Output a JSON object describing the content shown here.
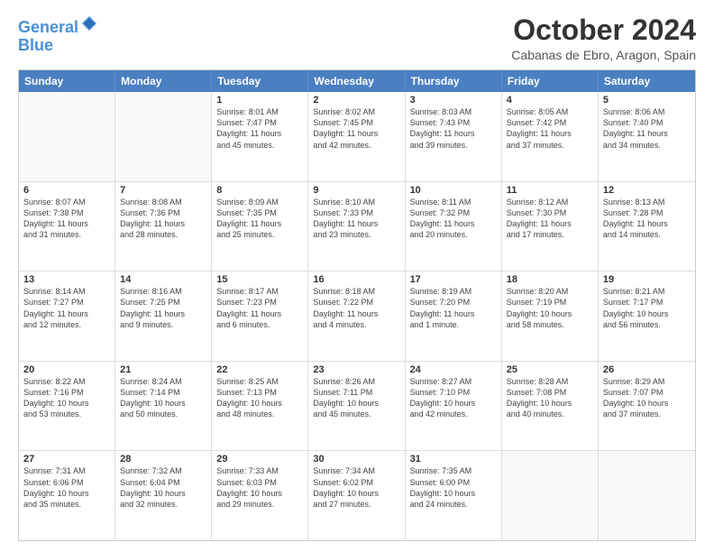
{
  "header": {
    "logo_line1": "General",
    "logo_line2": "Blue",
    "month_title": "October 2024",
    "location": "Cabanas de Ebro, Aragon, Spain"
  },
  "weekdays": [
    "Sunday",
    "Monday",
    "Tuesday",
    "Wednesday",
    "Thursday",
    "Friday",
    "Saturday"
  ],
  "weeks": [
    [
      {
        "day": "",
        "lines": []
      },
      {
        "day": "",
        "lines": []
      },
      {
        "day": "1",
        "lines": [
          "Sunrise: 8:01 AM",
          "Sunset: 7:47 PM",
          "Daylight: 11 hours",
          "and 45 minutes."
        ]
      },
      {
        "day": "2",
        "lines": [
          "Sunrise: 8:02 AM",
          "Sunset: 7:45 PM",
          "Daylight: 11 hours",
          "and 42 minutes."
        ]
      },
      {
        "day": "3",
        "lines": [
          "Sunrise: 8:03 AM",
          "Sunset: 7:43 PM",
          "Daylight: 11 hours",
          "and 39 minutes."
        ]
      },
      {
        "day": "4",
        "lines": [
          "Sunrise: 8:05 AM",
          "Sunset: 7:42 PM",
          "Daylight: 11 hours",
          "and 37 minutes."
        ]
      },
      {
        "day": "5",
        "lines": [
          "Sunrise: 8:06 AM",
          "Sunset: 7:40 PM",
          "Daylight: 11 hours",
          "and 34 minutes."
        ]
      }
    ],
    [
      {
        "day": "6",
        "lines": [
          "Sunrise: 8:07 AM",
          "Sunset: 7:38 PM",
          "Daylight: 11 hours",
          "and 31 minutes."
        ]
      },
      {
        "day": "7",
        "lines": [
          "Sunrise: 8:08 AM",
          "Sunset: 7:36 PM",
          "Daylight: 11 hours",
          "and 28 minutes."
        ]
      },
      {
        "day": "8",
        "lines": [
          "Sunrise: 8:09 AM",
          "Sunset: 7:35 PM",
          "Daylight: 11 hours",
          "and 25 minutes."
        ]
      },
      {
        "day": "9",
        "lines": [
          "Sunrise: 8:10 AM",
          "Sunset: 7:33 PM",
          "Daylight: 11 hours",
          "and 23 minutes."
        ]
      },
      {
        "day": "10",
        "lines": [
          "Sunrise: 8:11 AM",
          "Sunset: 7:32 PM",
          "Daylight: 11 hours",
          "and 20 minutes."
        ]
      },
      {
        "day": "11",
        "lines": [
          "Sunrise: 8:12 AM",
          "Sunset: 7:30 PM",
          "Daylight: 11 hours",
          "and 17 minutes."
        ]
      },
      {
        "day": "12",
        "lines": [
          "Sunrise: 8:13 AM",
          "Sunset: 7:28 PM",
          "Daylight: 11 hours",
          "and 14 minutes."
        ]
      }
    ],
    [
      {
        "day": "13",
        "lines": [
          "Sunrise: 8:14 AM",
          "Sunset: 7:27 PM",
          "Daylight: 11 hours",
          "and 12 minutes."
        ]
      },
      {
        "day": "14",
        "lines": [
          "Sunrise: 8:16 AM",
          "Sunset: 7:25 PM",
          "Daylight: 11 hours",
          "and 9 minutes."
        ]
      },
      {
        "day": "15",
        "lines": [
          "Sunrise: 8:17 AM",
          "Sunset: 7:23 PM",
          "Daylight: 11 hours",
          "and 6 minutes."
        ]
      },
      {
        "day": "16",
        "lines": [
          "Sunrise: 8:18 AM",
          "Sunset: 7:22 PM",
          "Daylight: 11 hours",
          "and 4 minutes."
        ]
      },
      {
        "day": "17",
        "lines": [
          "Sunrise: 8:19 AM",
          "Sunset: 7:20 PM",
          "Daylight: 11 hours",
          "and 1 minute."
        ]
      },
      {
        "day": "18",
        "lines": [
          "Sunrise: 8:20 AM",
          "Sunset: 7:19 PM",
          "Daylight: 10 hours",
          "and 58 minutes."
        ]
      },
      {
        "day": "19",
        "lines": [
          "Sunrise: 8:21 AM",
          "Sunset: 7:17 PM",
          "Daylight: 10 hours",
          "and 56 minutes."
        ]
      }
    ],
    [
      {
        "day": "20",
        "lines": [
          "Sunrise: 8:22 AM",
          "Sunset: 7:16 PM",
          "Daylight: 10 hours",
          "and 53 minutes."
        ]
      },
      {
        "day": "21",
        "lines": [
          "Sunrise: 8:24 AM",
          "Sunset: 7:14 PM",
          "Daylight: 10 hours",
          "and 50 minutes."
        ]
      },
      {
        "day": "22",
        "lines": [
          "Sunrise: 8:25 AM",
          "Sunset: 7:13 PM",
          "Daylight: 10 hours",
          "and 48 minutes."
        ]
      },
      {
        "day": "23",
        "lines": [
          "Sunrise: 8:26 AM",
          "Sunset: 7:11 PM",
          "Daylight: 10 hours",
          "and 45 minutes."
        ]
      },
      {
        "day": "24",
        "lines": [
          "Sunrise: 8:27 AM",
          "Sunset: 7:10 PM",
          "Daylight: 10 hours",
          "and 42 minutes."
        ]
      },
      {
        "day": "25",
        "lines": [
          "Sunrise: 8:28 AM",
          "Sunset: 7:08 PM",
          "Daylight: 10 hours",
          "and 40 minutes."
        ]
      },
      {
        "day": "26",
        "lines": [
          "Sunrise: 8:29 AM",
          "Sunset: 7:07 PM",
          "Daylight: 10 hours",
          "and 37 minutes."
        ]
      }
    ],
    [
      {
        "day": "27",
        "lines": [
          "Sunrise: 7:31 AM",
          "Sunset: 6:06 PM",
          "Daylight: 10 hours",
          "and 35 minutes."
        ]
      },
      {
        "day": "28",
        "lines": [
          "Sunrise: 7:32 AM",
          "Sunset: 6:04 PM",
          "Daylight: 10 hours",
          "and 32 minutes."
        ]
      },
      {
        "day": "29",
        "lines": [
          "Sunrise: 7:33 AM",
          "Sunset: 6:03 PM",
          "Daylight: 10 hours",
          "and 29 minutes."
        ]
      },
      {
        "day": "30",
        "lines": [
          "Sunrise: 7:34 AM",
          "Sunset: 6:02 PM",
          "Daylight: 10 hours",
          "and 27 minutes."
        ]
      },
      {
        "day": "31",
        "lines": [
          "Sunrise: 7:35 AM",
          "Sunset: 6:00 PM",
          "Daylight: 10 hours",
          "and 24 minutes."
        ]
      },
      {
        "day": "",
        "lines": []
      },
      {
        "day": "",
        "lines": []
      }
    ]
  ]
}
